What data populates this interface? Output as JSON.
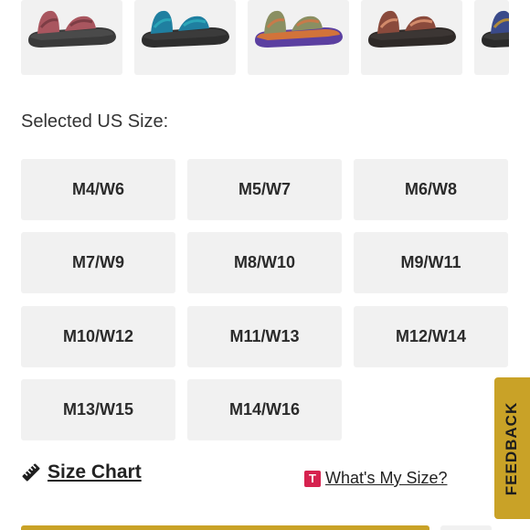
{
  "swatches": [
    {
      "name": "pink-maroon",
      "strap": "#a9565f",
      "strap_accent": "#7d3d45",
      "sole": "#3a3a3a",
      "midsole": "#4a4a4a"
    },
    {
      "name": "teal-blue",
      "strap": "#1f7fa0",
      "strap_accent": "#2ba6b8",
      "sole": "#2e2e2e",
      "midsole": "#3b3b3b"
    },
    {
      "name": "olive-purple",
      "strap": "#8a8f62",
      "strap_accent": "#c87a4a",
      "sole": "#5b3fa0",
      "midsole": "#d2733a"
    },
    {
      "name": "brown-pattern",
      "strap": "#8a4a3c",
      "strap_accent": "#d28a6a",
      "sole": "#2f2a28",
      "midsole": "#3c3634"
    },
    {
      "name": "navy-gold",
      "strap": "#3a4a8a",
      "strap_accent": "#b08a3a",
      "sole": "#2a2a2a",
      "midsole": "#3a3a3a"
    }
  ],
  "size_section": {
    "label": "Selected US Size:",
    "sizes": [
      "M4/W6",
      "M5/W7",
      "M6/W8",
      "M7/W9",
      "M8/W10",
      "M9/W11",
      "M10/W12",
      "M11/W13",
      "M12/W14",
      "M13/W15",
      "M14/W16"
    ]
  },
  "size_chart": {
    "label": "Size Chart",
    "icon": "ruler-icon"
  },
  "whats_my_size": {
    "badge": "T",
    "label": "What's My Size?"
  },
  "feedback": {
    "label": "FEEDBACK"
  },
  "colors": {
    "accent": "#c9a227",
    "tile": "#f1f1f1",
    "badge": "#d6224f"
  }
}
